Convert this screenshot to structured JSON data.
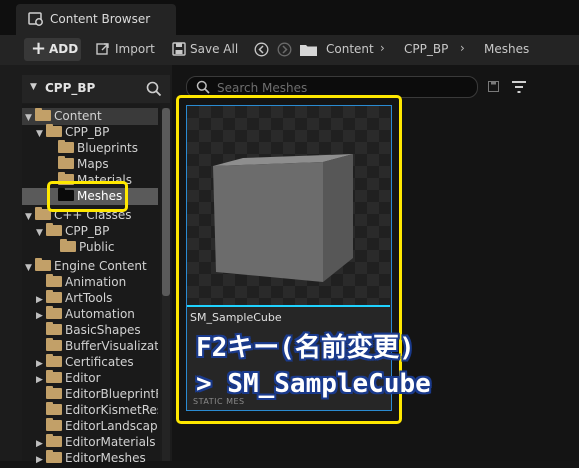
{
  "tab": {
    "title": "Content Browser"
  },
  "toolbar": {
    "add_label": "ADD",
    "import_label": "Import",
    "save_all_label": "Save All"
  },
  "breadcrumb": [
    "Content",
    "CPP_BP",
    "Meshes"
  ],
  "sidebar": {
    "header": "CPP_BP",
    "tree": [
      {
        "label": "Content",
        "depth": 0,
        "expanded": true
      },
      {
        "label": "CPP_BP",
        "depth": 1,
        "expanded": true
      },
      {
        "label": "Blueprints",
        "depth": 2
      },
      {
        "label": "Maps",
        "depth": 2
      },
      {
        "label": "Materials",
        "depth": 2
      },
      {
        "label": "Meshes",
        "depth": 2,
        "selected": true
      },
      {
        "label": "C++ Classes",
        "depth": 0,
        "expanded": true
      },
      {
        "label": "CPP_BP",
        "depth": 1,
        "expanded": true
      },
      {
        "label": "Public",
        "depth": 2
      },
      {
        "label": "Engine Content",
        "depth": 0,
        "expanded": true
      },
      {
        "label": "Animation",
        "depth": 1
      },
      {
        "label": "ArtTools",
        "depth": 1,
        "collapsed": true
      },
      {
        "label": "Automation",
        "depth": 1,
        "collapsed": true
      },
      {
        "label": "BasicShapes",
        "depth": 1
      },
      {
        "label": "BufferVisualizat",
        "depth": 1
      },
      {
        "label": "Certificates",
        "depth": 1,
        "collapsed": true
      },
      {
        "label": "Editor",
        "depth": 1,
        "collapsed": true
      },
      {
        "label": "EditorBlueprintR",
        "depth": 1
      },
      {
        "label": "EditorKismetRes",
        "depth": 1
      },
      {
        "label": "EditorLandscape",
        "depth": 1
      },
      {
        "label": "EditorMaterials",
        "depth": 1,
        "collapsed": true
      },
      {
        "label": "EditorMeshes",
        "depth": 1,
        "collapsed": true
      }
    ]
  },
  "search": {
    "placeholder": "Search Meshes"
  },
  "asset": {
    "name": "SM_SampleCube",
    "type": "STATIC MES"
  },
  "annotation": {
    "line1": "F2キー(名前変更)",
    "line2": "> SM_SampleCube"
  },
  "colors": {
    "highlight": "#ffe800",
    "selection": "#1fd2ff",
    "folder": "#c2a068"
  }
}
